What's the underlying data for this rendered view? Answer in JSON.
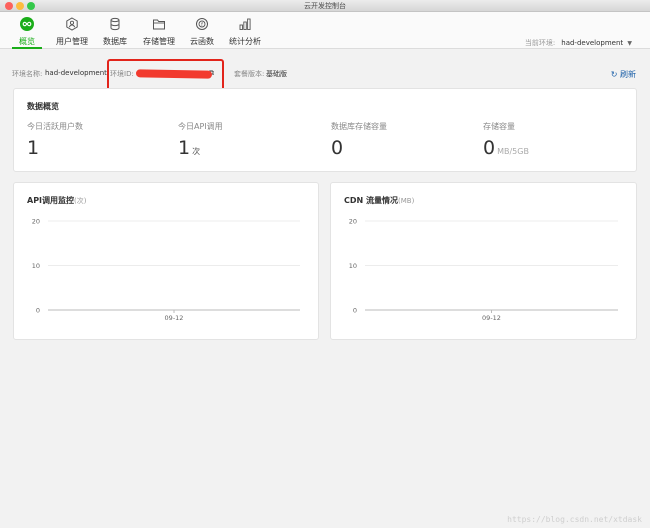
{
  "window": {
    "title": "云开发控制台"
  },
  "tabs": [
    {
      "label": "概览",
      "icon": "infinity-icon"
    },
    {
      "label": "用户管理",
      "icon": "user-hex-icon"
    },
    {
      "label": "数据库",
      "icon": "database-icon"
    },
    {
      "label": "存储管理",
      "icon": "folder-icon"
    },
    {
      "label": "云函数",
      "icon": "function-icon"
    },
    {
      "label": "统计分析",
      "icon": "bar-chart-icon"
    }
  ],
  "env": {
    "label": "当前环境:",
    "value": "had-development"
  },
  "info": {
    "env_name_label": "环境名称:",
    "env_name": "had-development",
    "env_id_label": "环境ID:",
    "plan_label": "套餐版本:",
    "plan": "基础版",
    "refresh": "刷新"
  },
  "overview": {
    "title": "数据概览",
    "stats": [
      {
        "label": "今日活跃用户数",
        "value": "1",
        "unit": ""
      },
      {
        "label": "今日API调用",
        "value": "1",
        "unit": "次"
      },
      {
        "label": "数据库存储容量",
        "value": "0",
        "unit": ""
      },
      {
        "label": "存储容量",
        "value": "0",
        "unit": "MB/5GB"
      }
    ]
  },
  "api_chart": {
    "title": "API调用监控",
    "unit": "(次)"
  },
  "cdn_chart": {
    "title": "CDN 流量情况",
    "unit": "(MB)"
  },
  "chart_data": [
    {
      "type": "line",
      "title": "API调用监控(次)",
      "x": [
        "09-12"
      ],
      "ylim": [
        0,
        20
      ],
      "yticks": [
        "20",
        "10",
        "0"
      ],
      "series": [],
      "grid": true
    },
    {
      "type": "line",
      "title": "CDN 流量情况(MB)",
      "x": [
        "09-12"
      ],
      "ylim": [
        0,
        20
      ],
      "yticks": [
        "20",
        "10",
        "0"
      ],
      "series": [],
      "grid": true
    }
  ],
  "colors": {
    "accent": "#1aad19",
    "highlight": "#e2241b",
    "link": "#1a5fa8"
  },
  "watermark": "https://blog.csdn.net/xtdask"
}
